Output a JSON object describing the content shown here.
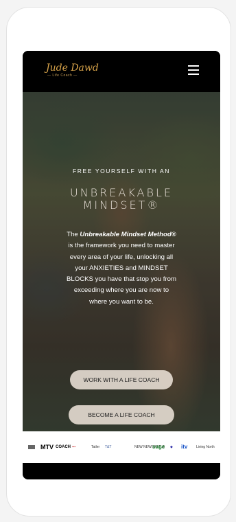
{
  "header": {
    "logo_name": "Jude Dawd",
    "logo_subtitle": "— Life Coach —",
    "menu_icon": "hamburger-menu-icon"
  },
  "hero": {
    "eyebrow": "FREE YOURSELF WITH AN",
    "title_line1": "UNBREAKABLE",
    "title_line2": "MINDSET®",
    "body_prefix": "The ",
    "body_bold": "Unbreakable Mindset Method®",
    "body_rest": " is the framework you need to master every area of your life, unlocking all your ANXIETIES and MINDSET BLOCKS you have that stop you from exceeding where you are now to where you want to be.",
    "button_primary": "WORK WITH A LIFE COACH",
    "button_secondary": "BECOME A LIFE COACH"
  },
  "press_logos": {
    "items": [
      "MTV",
      "COACH",
      "Tatler",
      "T&T",
      "sage",
      "itv",
      "Living North",
      "NEW NEWCASTLE"
    ]
  }
}
